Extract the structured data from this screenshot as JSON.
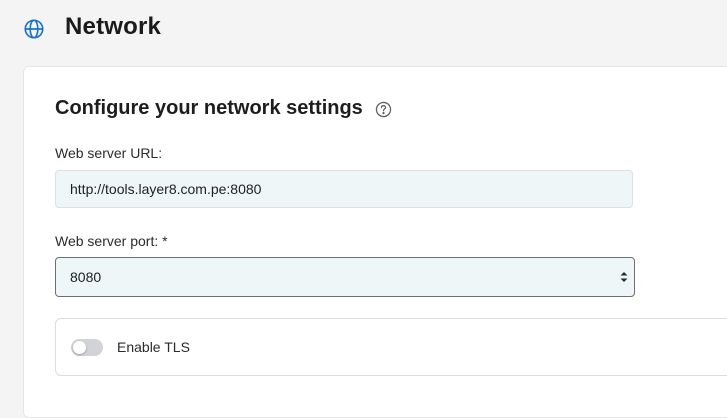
{
  "header": {
    "title": "Network",
    "icon": "globe-icon",
    "icon_color": "#1a73c8"
  },
  "card": {
    "section_title": "Configure your network settings",
    "help_icon": "question-circle-icon",
    "url_field": {
      "label": "Web server URL:",
      "value": "http://tools.layer8.com.pe:8080"
    },
    "port_field": {
      "label": "Web server port: *",
      "selected": "8080"
    },
    "tls": {
      "label": "Enable TLS",
      "enabled": false
    }
  }
}
